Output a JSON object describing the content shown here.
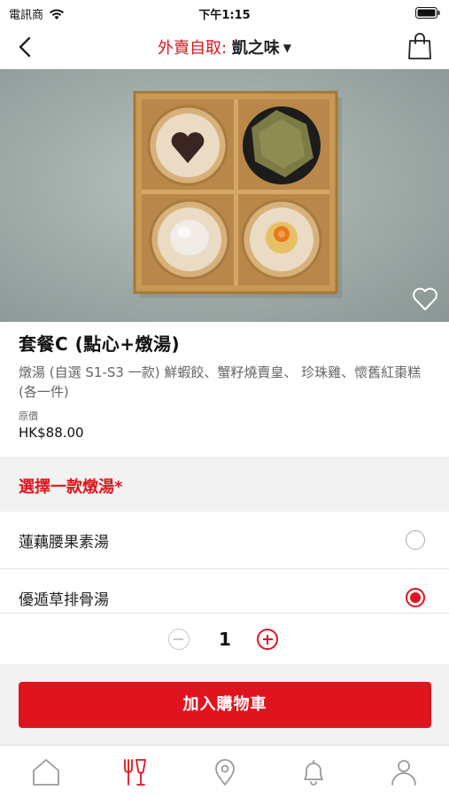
{
  "status": {
    "carrier": "電訊商",
    "time": "下午1:15"
  },
  "nav": {
    "mode": "外賣自取:",
    "store": "凱之味"
  },
  "product": {
    "name": "套餐C (點心+燉湯)",
    "description": "燉湯 (自選 S1-S3 一款) 鮮蝦餃、蟹籽燒賣皇、 珍珠雞、懷舊紅棗糕 (各一件)",
    "price_label": "原價",
    "price": "HK$88.00"
  },
  "section": {
    "title": "選擇一款燉湯*"
  },
  "options": [
    {
      "label": "蓮藕腰果素湯",
      "selected": false
    },
    {
      "label": "優遁草排骨湯",
      "selected": true
    }
  ],
  "quantity": {
    "value": "1"
  },
  "cta": {
    "label": "加入購物車"
  },
  "tabs": [
    {
      "icon": "home-icon"
    },
    {
      "icon": "fork-knife-icon"
    },
    {
      "icon": "location-pin-icon"
    },
    {
      "icon": "bell-icon"
    },
    {
      "icon": "profile-icon"
    }
  ],
  "colors": {
    "accent": "#e0141e",
    "inactive": "#9a9a9a"
  }
}
